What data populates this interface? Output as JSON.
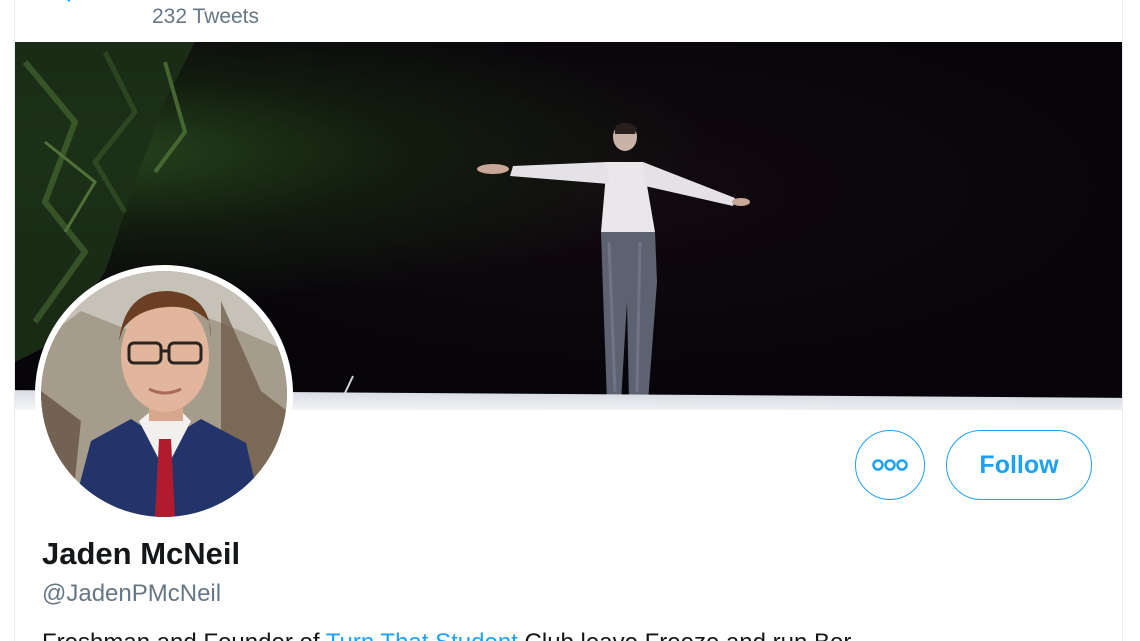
{
  "header": {
    "tweet_count": "232 Tweets",
    "back_icon": "arrow-left-icon"
  },
  "profile": {
    "display_name": "Jaden McNeil",
    "handle": "@JadenPMcNeil",
    "more_icon": "ellipsis-icon",
    "follow_label": "Follow",
    "bio_prefix": "Freshman and Founder of ",
    "bio_link": "Turn That Student",
    "bio_suffix": " Club leave Freeze and run Bor..."
  },
  "colors": {
    "accent": "#1da1f2",
    "text_primary": "#14171a",
    "text_secondary": "#657786"
  }
}
